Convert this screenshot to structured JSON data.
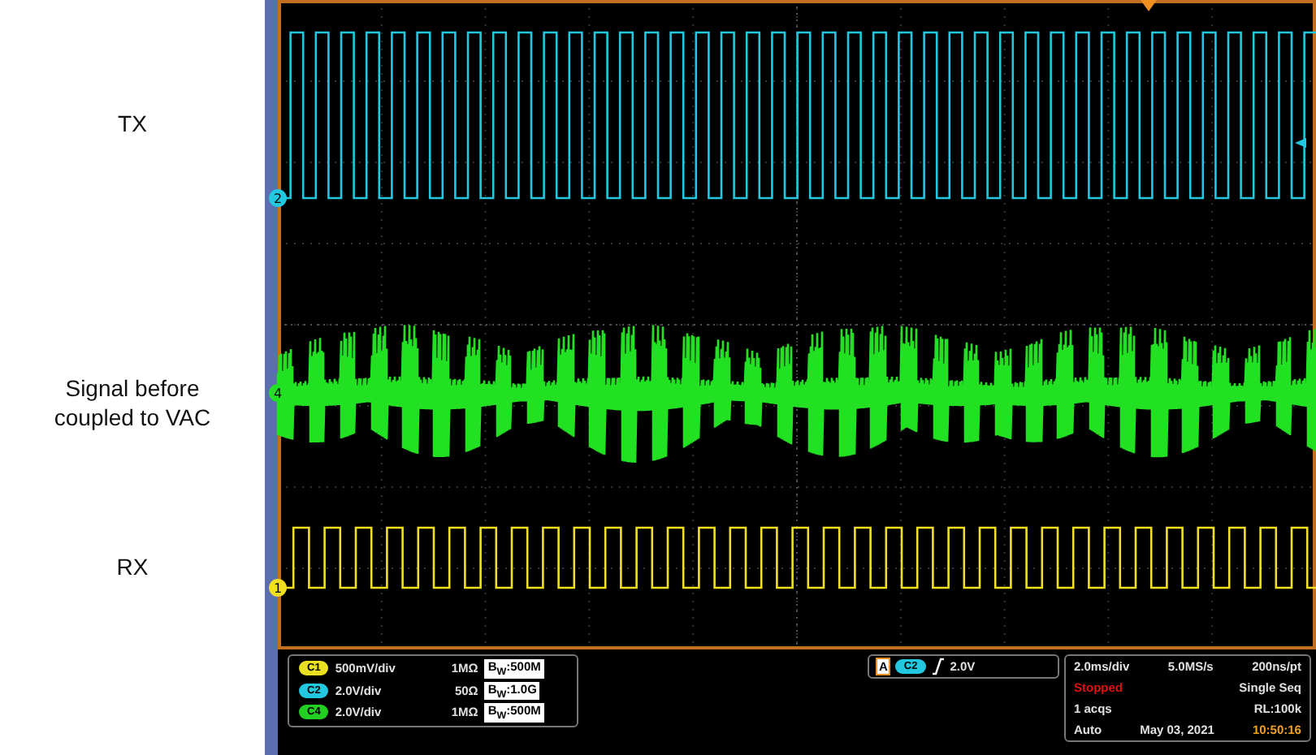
{
  "traces": [
    {
      "label": "TX",
      "marker": "2",
      "color": "#22c8e0",
      "kind": "square"
    },
    {
      "label": "Signal before coupled to VAC",
      "marker": "4",
      "color": "#22e022",
      "kind": "noise"
    },
    {
      "label": "RX",
      "marker": "1",
      "color": "#f0e020",
      "kind": "square"
    }
  ],
  "channels": [
    {
      "badge": "C1",
      "color": "#e8e020",
      "scale": "500mV/div",
      "impedance": "1MΩ",
      "bandwidth": "B$_{W}$:500M"
    },
    {
      "badge": "C2",
      "color": "#22c8e0",
      "scale": "2.0V/div",
      "impedance": "50Ω",
      "bandwidth": "B$_{W}$:1.0G"
    },
    {
      "badge": "C4",
      "color": "#22d022",
      "scale": "2.0V/div",
      "impedance": "1MΩ",
      "bandwidth": "B$_{W}$:500M"
    }
  ],
  "trigger": {
    "mode": "A",
    "badge": "C2",
    "color": "#22c8e0",
    "level": "2.0V"
  },
  "acquisition": [
    [
      {
        "text": "2.0ms/div",
        "kind": "value"
      },
      {
        "text": "5.0MS/s",
        "kind": "value"
      },
      {
        "text": "200ns/pt",
        "kind": "value"
      }
    ],
    [
      {
        "text": "Stopped",
        "kind": "status"
      },
      {
        "text": "Single Seq",
        "kind": "value"
      }
    ],
    [
      {
        "text": "1 acqs",
        "kind": "value"
      },
      {
        "text": "RL:100k",
        "kind": "value"
      }
    ],
    [
      {
        "text": "Auto",
        "kind": "value"
      },
      {
        "text": "May 03, 2021",
        "kind": "value"
      },
      {
        "text": "10:50:16",
        "kind": "time"
      }
    ]
  ]
}
